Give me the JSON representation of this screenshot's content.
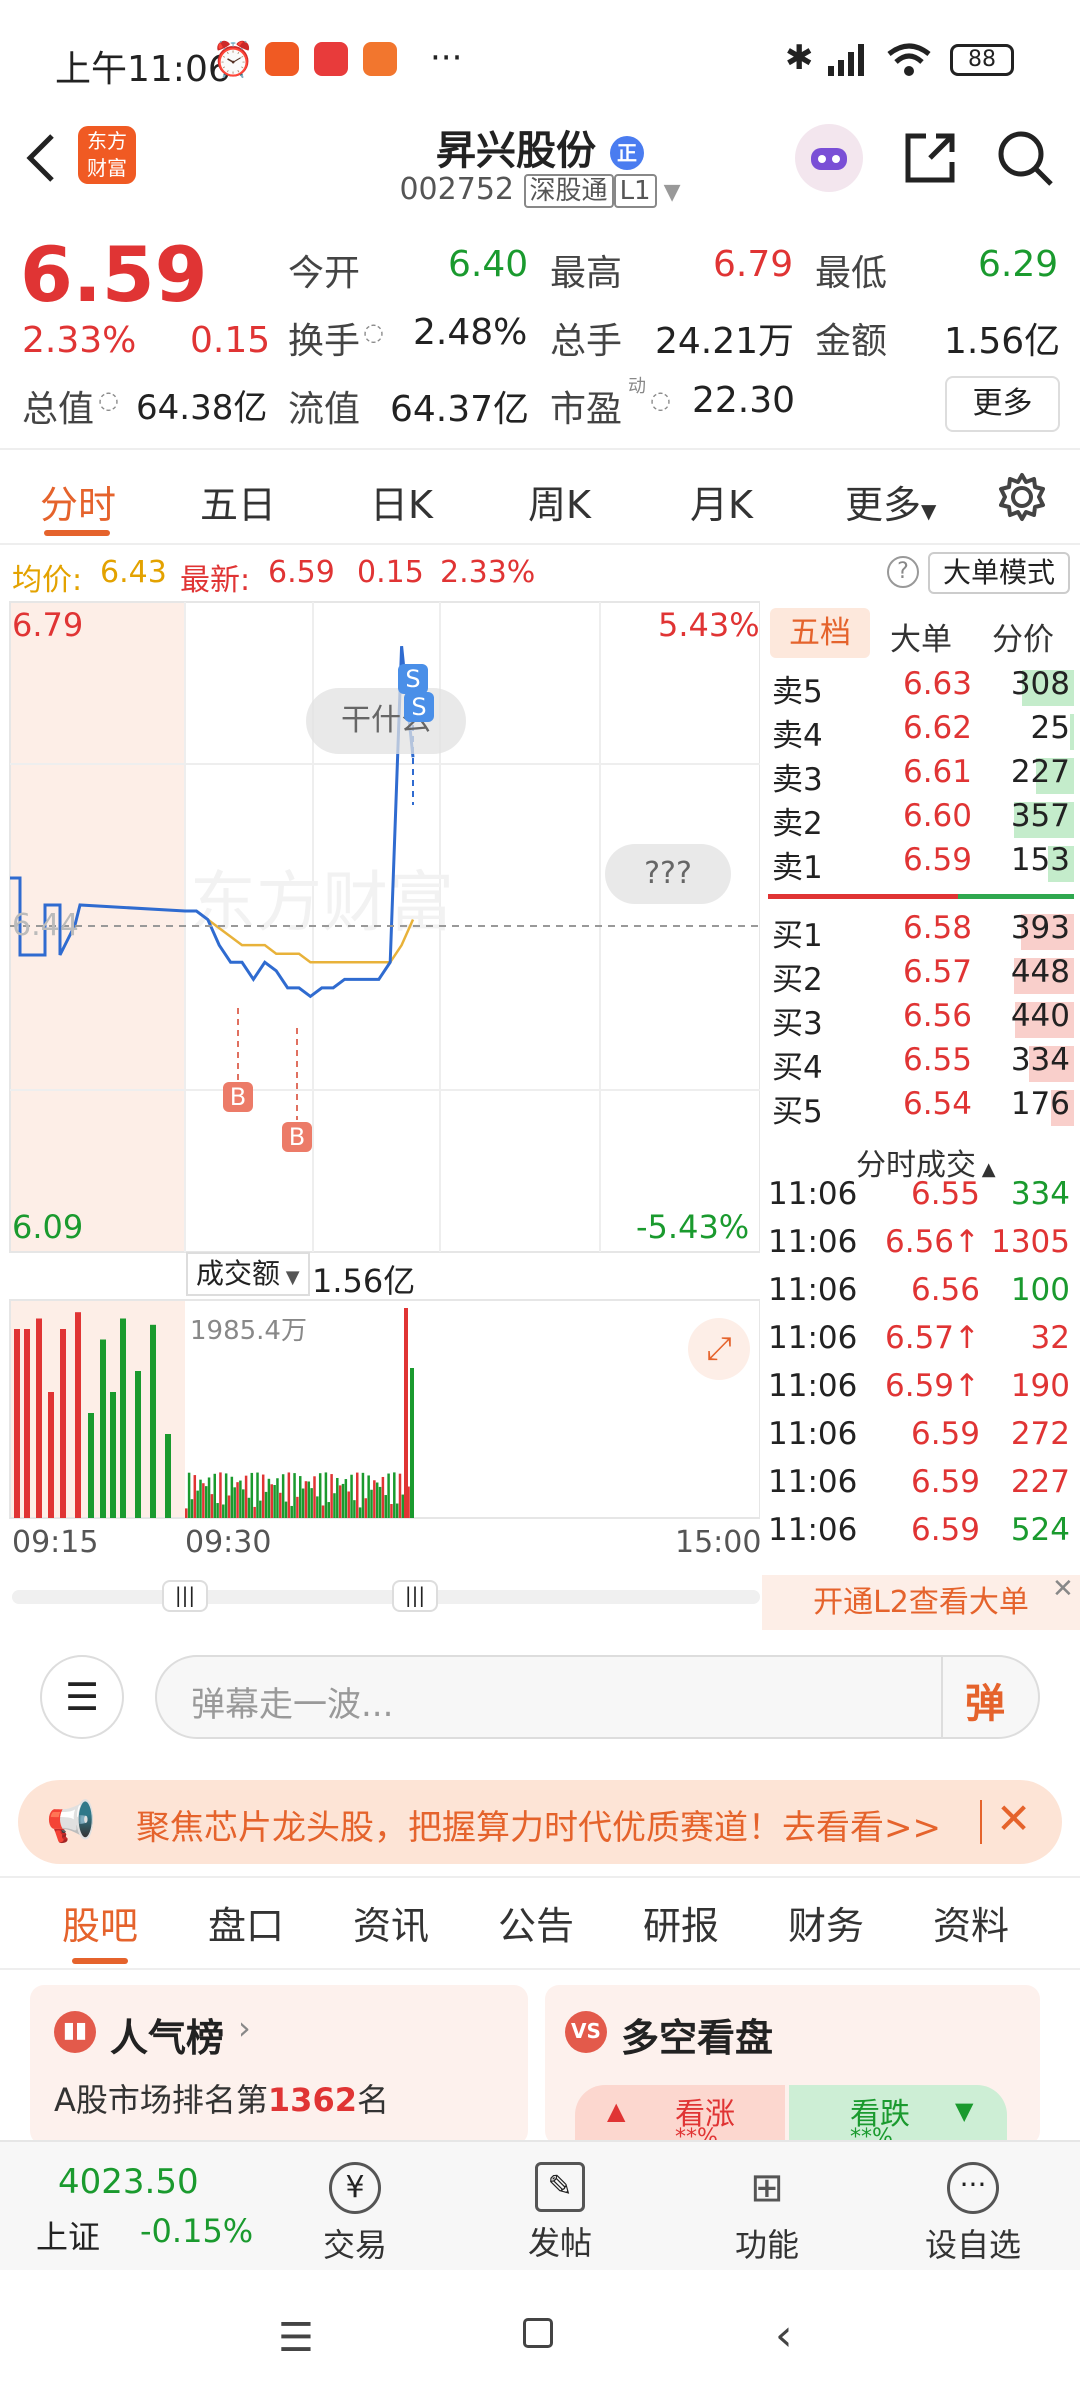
{
  "status_bar": {
    "time": "上午11:06",
    "battery": "88"
  },
  "header": {
    "app_logo": "东方财富",
    "stock_name": "昇兴股份",
    "badge": "正",
    "code": "002752",
    "tag1": "深股通",
    "tag2": "L1"
  },
  "quote": {
    "price": "6.59",
    "change_pct": "2.33%",
    "change": "0.15",
    "open_label": "今开",
    "open": "6.40",
    "high_label": "最高",
    "high": "6.79",
    "low_label": "最低",
    "low": "6.29",
    "turnover_label": "换手",
    "turnover": "2.48%",
    "volume_label": "总手",
    "volume": "24.21万",
    "amount_label": "金额",
    "amount": "1.56亿",
    "mktcap_label": "总值",
    "mktcap": "64.38亿",
    "float_label": "流值",
    "float": "64.37亿",
    "pe_label": "市盈",
    "pe_sup": "动",
    "pe": "22.30",
    "more_button": "更多"
  },
  "tabs": [
    "分时",
    "五日",
    "日K",
    "周K",
    "月K",
    "更多"
  ],
  "info_line": {
    "avg_label": "均价:",
    "avg": "6.43",
    "latest_label": "最新:",
    "latest": "6.59",
    "chg": "0.15",
    "pct": "2.33%",
    "mode_button": "大单模式"
  },
  "chart": {
    "y_top": "6.79",
    "y_bottom": "6.09",
    "y_mid": "6.44",
    "pct_top": "5.43%",
    "pct_bottom": "-5.43%",
    "bubble1": "干什么",
    "bubble2": "???",
    "watermark": "东方财富",
    "vol_selector": "成交额",
    "vol_total": "1.56亿",
    "vol_max": "1985.4万",
    "x_start": "09:15",
    "x_mid": "09:30",
    "x_end": "15:00",
    "marker_s": "S",
    "marker_b": "B"
  },
  "chart_data": {
    "type": "line",
    "x": [
      "09:30",
      "09:35",
      "09:40",
      "09:45",
      "09:50",
      "09:55",
      "10:00",
      "10:05",
      "10:10",
      "10:15",
      "10:20",
      "10:25",
      "10:30",
      "10:35",
      "10:40",
      "10:45",
      "10:50",
      "10:55",
      "11:00",
      "11:03",
      "11:06"
    ],
    "series": [
      {
        "values": [
          6.44,
          6.44,
          6.43,
          6.4,
          6.38,
          6.38,
          6.36,
          6.38,
          6.37,
          6.35,
          6.35,
          6.34,
          6.35,
          6.35,
          6.36,
          6.36,
          6.36,
          6.36,
          6.38,
          6.75,
          6.62
        ]
      },
      {
        "values": [
          6.44,
          6.44,
          6.43,
          6.42,
          6.41,
          6.4,
          6.4,
          6.4,
          6.39,
          6.39,
          6.39,
          6.38,
          6.38,
          6.38,
          6.38,
          6.38,
          6.38,
          6.38,
          6.38,
          6.4,
          6.43
        ]
      }
    ],
    "ylim": [
      6.09,
      6.79
    ],
    "grid": true
  },
  "order_book": {
    "tabs": [
      "五档",
      "大单",
      "分价"
    ],
    "asks": [
      {
        "label": "卖5",
        "price": "6.63",
        "vol": "308",
        "frac": 0.86
      },
      {
        "label": "卖4",
        "price": "6.62",
        "vol": "25",
        "frac": 0.07
      },
      {
        "label": "卖3",
        "price": "6.61",
        "vol": "227",
        "frac": 0.64
      },
      {
        "label": "卖2",
        "price": "6.60",
        "vol": "357",
        "frac": 1.0
      },
      {
        "label": "卖1",
        "price": "6.59",
        "vol": "153",
        "frac": 0.43
      }
    ],
    "bids": [
      {
        "label": "买1",
        "price": "6.58",
        "vol": "393",
        "frac": 0.88
      },
      {
        "label": "买2",
        "price": "6.57",
        "vol": "448",
        "frac": 1.0
      },
      {
        "label": "买3",
        "price": "6.56",
        "vol": "440",
        "frac": 0.98
      },
      {
        "label": "买4",
        "price": "6.55",
        "vol": "334",
        "frac": 0.75
      },
      {
        "label": "买5",
        "price": "6.54",
        "vol": "176",
        "frac": 0.39
      }
    ],
    "trades_title": "分时成交",
    "trades": [
      {
        "time": "11:06",
        "price": "6.55",
        "vol": "334",
        "dir": "g"
      },
      {
        "time": "11:06",
        "price": "6.56↑",
        "vol": "1305",
        "dir": "r"
      },
      {
        "time": "11:06",
        "price": "6.56",
        "vol": "100",
        "dir": "g"
      },
      {
        "time": "11:06",
        "price": "6.57↑",
        "vol": "32",
        "dir": "r"
      },
      {
        "time": "11:06",
        "price": "6.59↑",
        "vol": "190",
        "dir": "r"
      },
      {
        "time": "11:06",
        "price": "6.59",
        "vol": "272",
        "dir": "r"
      },
      {
        "time": "11:06",
        "price": "6.59",
        "vol": "227",
        "dir": "r"
      },
      {
        "time": "11:06",
        "price": "6.59",
        "vol": "524",
        "dir": "g"
      }
    ],
    "l2_promo": "开通L2查看大单"
  },
  "danmu": {
    "placeholder": "弹幕走一波...",
    "send_label": "弹"
  },
  "banner": {
    "text": "聚焦芯片龙头股，把握算力时代优质赛道！去看看>>"
  },
  "bottom_tabs": [
    "股吧",
    "盘口",
    "资讯",
    "公告",
    "研报",
    "财务",
    "资料"
  ],
  "cards": {
    "popularity_title": "人气榜",
    "popularity_prefix": "A股市场排名第",
    "popularity_rank": "1362",
    "popularity_suffix": "名",
    "vs_title": "多空看盘",
    "bull": "看涨",
    "bear": "看跌",
    "masked": "**%"
  },
  "bottom_bar": {
    "index_value": "4023.50",
    "index_name": "上证",
    "index_chg": "-0.15%",
    "trade": "交易",
    "post": "发帖",
    "functions": "功能",
    "watchlist": "设自选"
  }
}
